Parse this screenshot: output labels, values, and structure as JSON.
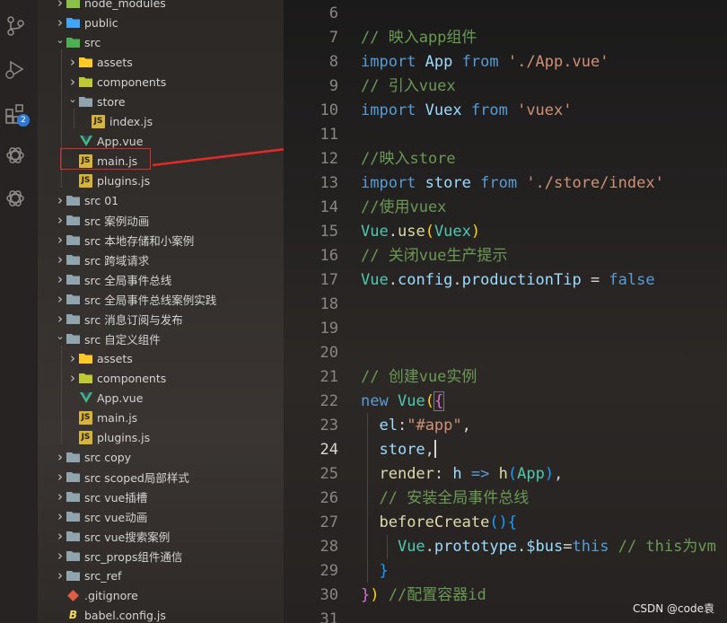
{
  "activity_bar": {
    "icons": [
      "source-control-icon",
      "run-debug-icon",
      "extensions-icon",
      "openai-icon",
      "openai-icon"
    ],
    "extensions_badge": "2"
  },
  "explorer": {
    "rows": [
      {
        "label": "node_modules",
        "kind": "folder-node",
        "expanded": false
      },
      {
        "label": "public",
        "kind": "folder-public",
        "expanded": false
      },
      {
        "label": "src",
        "kind": "folder-src",
        "expanded": true
      },
      {
        "label": "assets",
        "kind": "folder-assets",
        "expanded": false
      },
      {
        "label": "components",
        "kind": "folder-components",
        "expanded": false
      },
      {
        "label": "store",
        "kind": "folder-plain",
        "expanded": true
      },
      {
        "label": "index.js",
        "kind": "js"
      },
      {
        "label": "App.vue",
        "kind": "vue"
      },
      {
        "label": "main.js",
        "kind": "js",
        "highlighted": true
      },
      {
        "label": "plugins.js",
        "kind": "js"
      },
      {
        "label": "src 01",
        "kind": "folder-plain",
        "expanded": false
      },
      {
        "label": "src 案例动画",
        "kind": "folder-plain",
        "expanded": false
      },
      {
        "label": "src 本地存储和小案例",
        "kind": "folder-plain",
        "expanded": false
      },
      {
        "label": "src 跨域请求",
        "kind": "folder-plain",
        "expanded": false
      },
      {
        "label": "src 全局事件总线",
        "kind": "folder-plain",
        "expanded": false
      },
      {
        "label": "src 全局事件总线案例实践",
        "kind": "folder-plain",
        "expanded": false
      },
      {
        "label": "src 消息订阅与发布",
        "kind": "folder-plain",
        "expanded": false
      },
      {
        "label": "src 自定义组件",
        "kind": "folder-plain",
        "expanded": true
      },
      {
        "label": "assets",
        "kind": "folder-assets",
        "expanded": false
      },
      {
        "label": "components",
        "kind": "folder-components",
        "expanded": false
      },
      {
        "label": "App.vue",
        "kind": "vue"
      },
      {
        "label": "main.js",
        "kind": "js"
      },
      {
        "label": "plugins.js",
        "kind": "js"
      },
      {
        "label": "src copy",
        "kind": "folder-plain",
        "expanded": false
      },
      {
        "label": "src scoped局部样式",
        "kind": "folder-plain",
        "expanded": false
      },
      {
        "label": "src vue插槽",
        "kind": "folder-plain",
        "expanded": false
      },
      {
        "label": "src vue动画",
        "kind": "folder-plain",
        "expanded": false
      },
      {
        "label": "src vue搜索案例",
        "kind": "folder-plain",
        "expanded": false
      },
      {
        "label": "src_props组件通信",
        "kind": "folder-plain",
        "expanded": false
      },
      {
        "label": "src_ref",
        "kind": "folder-plain",
        "expanded": false
      },
      {
        "label": ".gitignore",
        "kind": "git"
      },
      {
        "label": "babel.config.js",
        "kind": "babel"
      }
    ]
  },
  "editor": {
    "line_numbers": [
      "6",
      "7",
      "8",
      "9",
      "10",
      "11",
      "12",
      "13",
      "14",
      "15",
      "16",
      "17",
      "18",
      "19",
      "20",
      "21",
      "22",
      "23",
      "24",
      "25",
      "26",
      "27",
      "28",
      "29",
      "30",
      "31"
    ],
    "active_line": "24"
  },
  "watermark": "CSDN @code袁"
}
